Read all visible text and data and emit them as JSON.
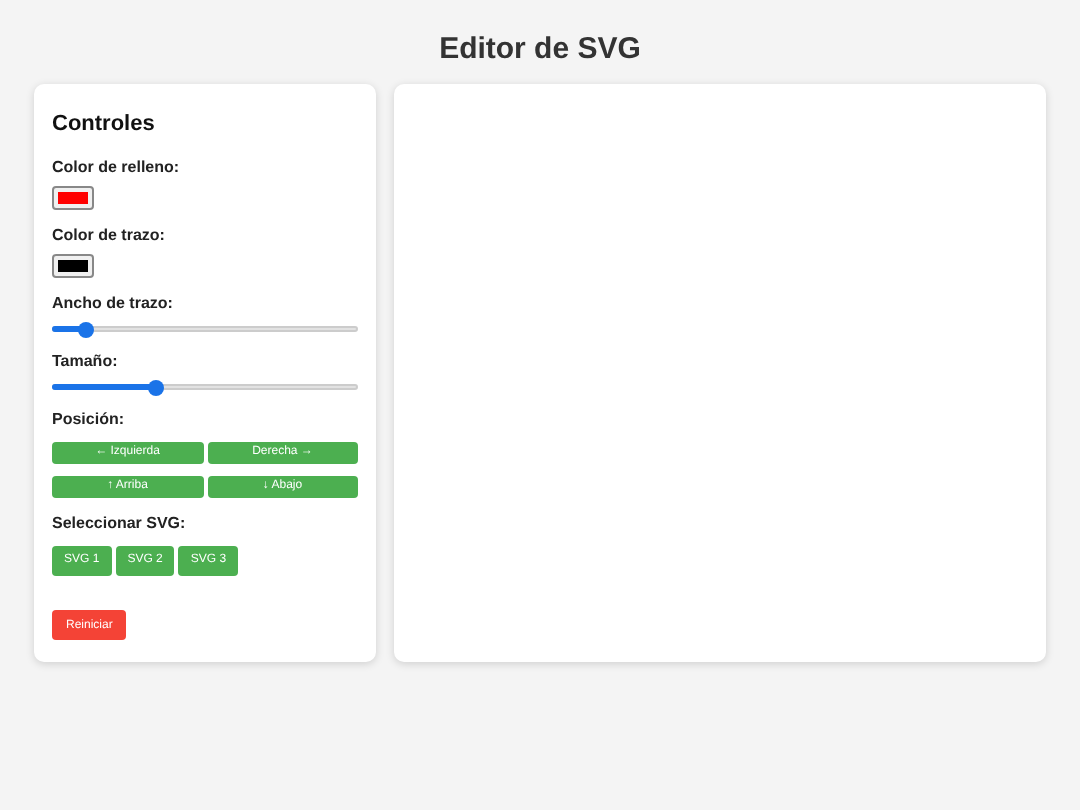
{
  "title": "Editor de SVG",
  "controls": {
    "heading": "Controles",
    "fill": {
      "label": "Color de relleno:",
      "color": "#ff0000"
    },
    "stroke": {
      "label": "Color de trazo:",
      "color": "#000000"
    },
    "stroke_width": {
      "label": "Ancho de trazo:",
      "level": 0.11
    },
    "size": {
      "label": "Tamaño:",
      "level": 0.34
    },
    "position": {
      "label": "Posición:",
      "buttons": [
        "← Izquierda",
        "Derecha →",
        "↑ Arriba",
        "↓ Abajo"
      ]
    },
    "select": {
      "label": "Seleccionar SVG:",
      "buttons": [
        "SVG 1",
        "SVG 2",
        "SVG 3"
      ]
    },
    "reset": "Reiniciar"
  }
}
